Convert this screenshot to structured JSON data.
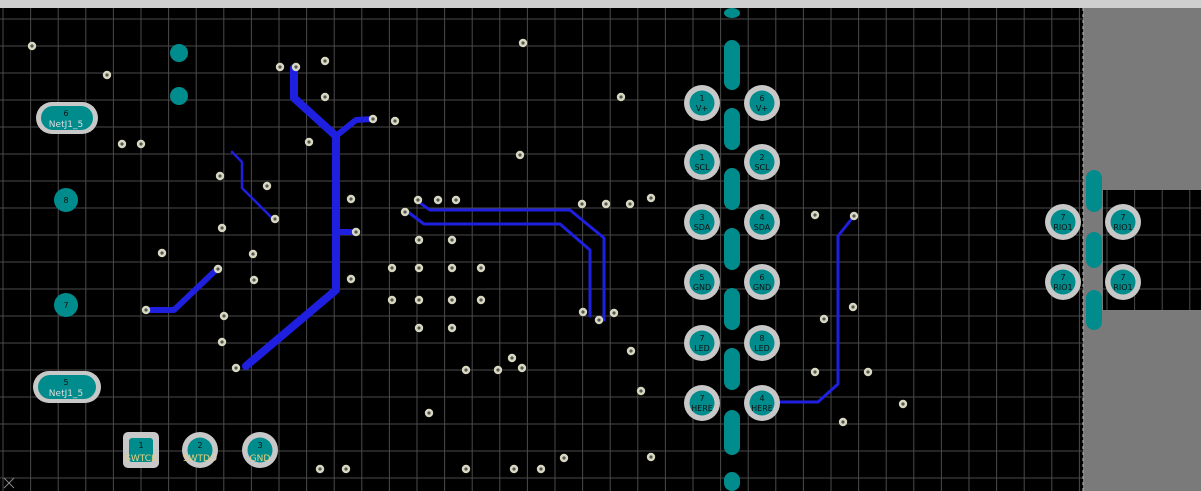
{
  "canvas": {
    "background": "#000000",
    "grid_color": "#4a4a4a",
    "keepout_color": "#7a7a7a",
    "trace_color": "#1f1fe0",
    "pad_fill": "#008c8c",
    "pad_ring": "#c8c8c8",
    "via_ring": "#c8c8b0"
  },
  "left_pads": [
    {
      "number": "6",
      "net": "NetJ1_5"
    },
    {
      "number": "8",
      "net": ""
    },
    {
      "number": "7",
      "net": ""
    },
    {
      "number": "5",
      "net": "NetJ1_5"
    }
  ],
  "header_pads_left": [
    {
      "number": "1",
      "net": "V+"
    },
    {
      "number": "1",
      "net": "SCL"
    },
    {
      "number": "3",
      "net": "SDA"
    },
    {
      "number": "5",
      "net": "GND"
    },
    {
      "number": "7",
      "net": "LED"
    },
    {
      "number": "7",
      "net": "HERE"
    }
  ],
  "header_pads_right": [
    {
      "number": "6",
      "net": "V+"
    },
    {
      "number": "2",
      "net": "SCL"
    },
    {
      "number": "4",
      "net": "SDA"
    },
    {
      "number": "6",
      "net": "GND"
    },
    {
      "number": "8",
      "net": "LED"
    },
    {
      "number": "4",
      "net": "HERE"
    }
  ],
  "bottom_pads": [
    {
      "number": "1",
      "net": "SWTCK"
    },
    {
      "number": "2",
      "net": "SWTDO"
    },
    {
      "number": "3",
      "net": "GND"
    }
  ],
  "right_pads": [
    {
      "number": "7",
      "net": "RIO1"
    },
    {
      "number": "7",
      "net": "RIO1"
    },
    {
      "number": "7",
      "net": "RIO1"
    },
    {
      "number": "7",
      "net": "RIO1"
    }
  ]
}
